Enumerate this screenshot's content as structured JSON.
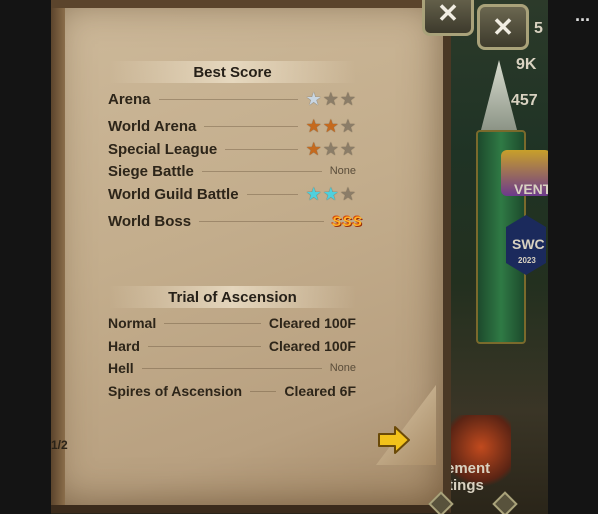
{
  "best_score": {
    "title": "Best Score",
    "rows": [
      {
        "label": "Arena",
        "stars": [
          "silver",
          "empty",
          "empty"
        ]
      },
      {
        "label": "World Arena",
        "stars": [
          "bronze",
          "bronze",
          "empty"
        ]
      },
      {
        "label": "Special League",
        "stars": [
          "bronze",
          "empty",
          "empty"
        ]
      },
      {
        "label": "Siege Battle",
        "value": "None"
      },
      {
        "label": "World Guild Battle",
        "stars": [
          "cyan",
          "cyan",
          "empty"
        ]
      },
      {
        "label": "World Boss",
        "value": "SSS"
      }
    ]
  },
  "trial": {
    "title": "Trial of Ascension",
    "rows": [
      {
        "label": "Normal",
        "value": "Cleared 100F"
      },
      {
        "label": "Hard",
        "value": "Cleared 100F"
      },
      {
        "label": "Hell",
        "value": "None"
      },
      {
        "label": "Spires of Ascension",
        "value": "Cleared 6F"
      }
    ]
  },
  "pagination": {
    "page_label": "1/2"
  },
  "close_glyph": "✕",
  "menu_glyph": "···",
  "scene_text": {
    "t1": "5",
    "t2": "9K",
    "t3": "457",
    "t4": "VENT",
    "t5": "SWC",
    "t6": "2023",
    "t7": "ement",
    "t8": "tings"
  },
  "colors": {
    "star_silver": "#c9d6e2",
    "star_bronze": "#c56a1e",
    "star_cyan": "#4fd0dd",
    "star_empty": "#8b7d68",
    "sss": "#ffb52a",
    "arrow": "#f2c21b"
  }
}
